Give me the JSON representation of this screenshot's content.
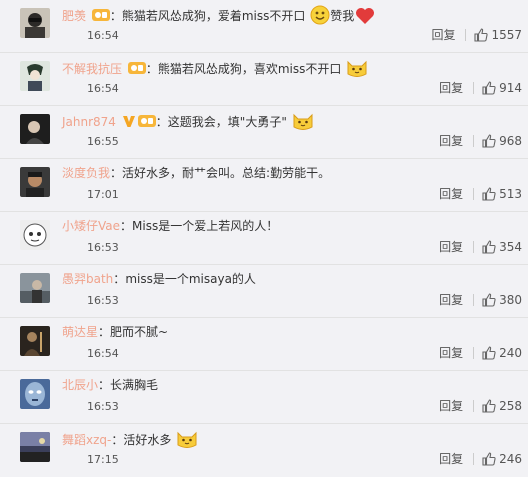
{
  "comments": [
    {
      "username": "肥羡",
      "content": "熊猫若风怂成狗，爱着miss不开口",
      "after": "赞我",
      "emoji": "smile-emoji",
      "emoji2": "heart-icon",
      "time": "16:54",
      "reply": "回复",
      "likes": "1557",
      "badge": "vip-badge",
      "avatar_color": "#c9c3b8"
    },
    {
      "username": "不解我抗压",
      "content": "熊猫若风怂成狗，喜欢miss不开口",
      "after": "",
      "emoji": "cat-emoji",
      "time": "16:54",
      "reply": "回复",
      "likes": "914",
      "badge": "vip-badge",
      "avatar_color": "#dfe6df"
    },
    {
      "username": "Jahnr874",
      "content": "这题我会，填\"大勇子\"",
      "after": "",
      "emoji": "cat-emoji",
      "time": "16:55",
      "reply": "回复",
      "likes": "968",
      "badge": "verified-v-badge",
      "avatar_color": "#1e1e1e"
    },
    {
      "username": "淡度负我",
      "content": "活好水多，耐艹会叫。总结:勤劳能干。",
      "after": "",
      "time": "17:01",
      "reply": "回复",
      "likes": "513",
      "avatar_color": "#3a3a3a"
    },
    {
      "username": "小矮仔Vae",
      "content": "Miss是一个爱上若风的人！",
      "after": "",
      "time": "16:53",
      "reply": "回复",
      "likes": "354",
      "avatar_color": "#eeeeee"
    },
    {
      "username": "愚羿bath",
      "content": "miss是一个misaya的人",
      "after": "",
      "time": "16:53",
      "reply": "回复",
      "likes": "380",
      "avatar_color": "#6f7880"
    },
    {
      "username": "萌达星",
      "content": "肥而不腻~",
      "after": "",
      "time": "16:54",
      "reply": "回复",
      "likes": "240",
      "avatar_color": "#2a241e"
    },
    {
      "username": "北辰小",
      "content": "长满胸毛",
      "after": "",
      "time": "16:53",
      "reply": "回复",
      "likes": "258",
      "avatar_color": "#4a6a9a"
    },
    {
      "username": "舞蹈xzq-",
      "content": "活好水多",
      "after": "",
      "emoji": "cat-emoji",
      "time": "17:15",
      "reply": "回复",
      "likes": "246",
      "avatar_color": "#6a6f8a"
    }
  ]
}
